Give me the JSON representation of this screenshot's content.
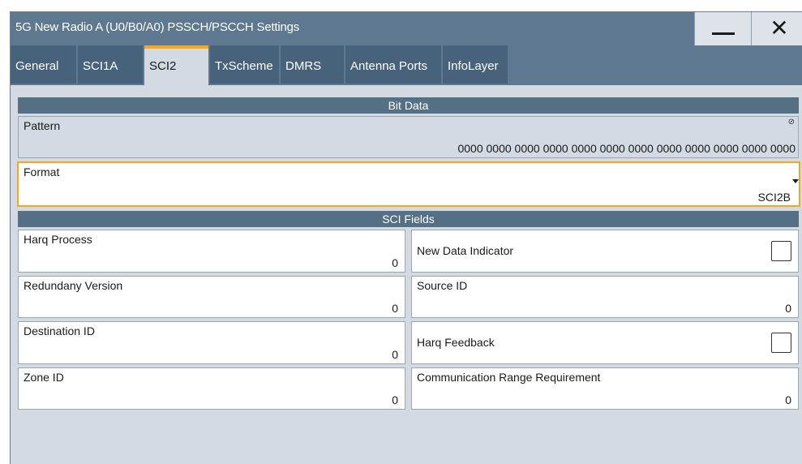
{
  "window": {
    "title": "5G New Radio A (U0/B0/A0) PSSCH/PSCCH Settings",
    "minimize_symbol": "—",
    "close_symbol": "✕"
  },
  "tabs": [
    {
      "label": "General"
    },
    {
      "label": "SCI1A"
    },
    {
      "label": "SCI2",
      "active": true
    },
    {
      "label": "TxScheme"
    },
    {
      "label": "DMRS"
    },
    {
      "label": "Antenna Ports"
    },
    {
      "label": "InfoLayer"
    }
  ],
  "bit_data": {
    "header": "Bit Data",
    "pattern_label": "Pattern",
    "pattern_value": "0000 0000 0000 0000 0000 0000 0000 0000 0000 0000 0000 0000",
    "format_label": "Format",
    "format_value": "SCI2B"
  },
  "sci_fields": {
    "header": "SCI Fields",
    "harq_process": {
      "label": "Harq Process",
      "value": "0"
    },
    "new_data_indicator": {
      "label": "New Data Indicator",
      "checked": false
    },
    "redundancy_version": {
      "label": "Redundany Version",
      "value": "0"
    },
    "source_id": {
      "label": "Source ID",
      "value": "0"
    },
    "destination_id": {
      "label": "Destination ID",
      "value": "0"
    },
    "harq_feedback": {
      "label": "Harq Feedback",
      "checked": false
    },
    "zone_id": {
      "label": "Zone ID",
      "value": "0"
    },
    "communication_range": {
      "label": "Communication Range Requirement",
      "value": "0"
    }
  },
  "icons": {
    "readonly": "readonly-icon",
    "dropdown": "chevron-down-icon"
  },
  "colors": {
    "accent": "#f7a81a",
    "titlebar": "#5d788f",
    "section_header": "#557085",
    "panel": "#d3dae1"
  }
}
